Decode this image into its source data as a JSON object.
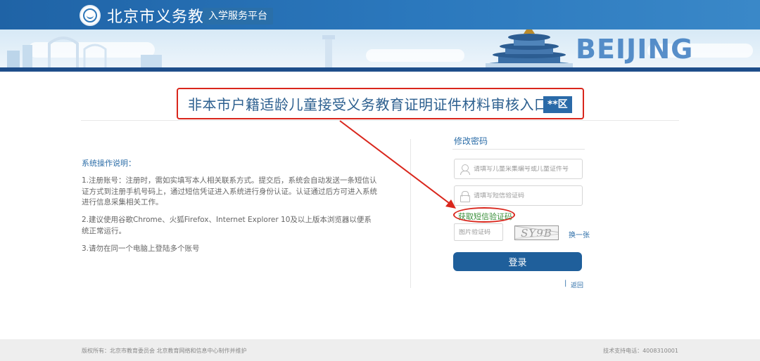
{
  "header": {
    "title": "北京市义务教育",
    "subtitle": "入学服务平台",
    "skyline_text": "BEIJING"
  },
  "entry": {
    "title": "非本市户籍适龄儿童接受义务教育证明证件材料审核入口",
    "district": "**区"
  },
  "instructions": {
    "heading": "系统操作说明：",
    "items": [
      "1.注册账号：注册时，需如实填写本人相关联系方式。提交后，系统会自动发送一条短信认证方式到注册手机号码上，通过短信凭证进入系统进行身份认证。认证通过后方可进入系统进行信息采集相关工作。",
      "2.建议使用谷歌Chrome、火狐Firefox、Internet Explorer 10及以上版本浏览器以便系统正常运行。",
      "3.请勿在同一个电脑上登陆多个账号"
    ]
  },
  "form": {
    "title": "修改密码",
    "id_placeholder": "请填写儿童采集编号或儿童证件号",
    "sms_placeholder": "请填写短信验证码",
    "sms_link": "获取短信验证码",
    "captcha_placeholder": "图片验证码",
    "captcha_text": "SY9B",
    "refresh_link": "换一张",
    "login_button": "登录",
    "separator": "|",
    "back_link": "返回"
  },
  "footer": {
    "left": "版权所有：北京市教育委员会 北京教育网络和信息中心制作并维护",
    "right": "技术支持电话：4008310001"
  },
  "colors": {
    "brand_blue": "#1f5f9b",
    "annotation_red": "#d9261c",
    "link_green": "#3a8f3a"
  }
}
